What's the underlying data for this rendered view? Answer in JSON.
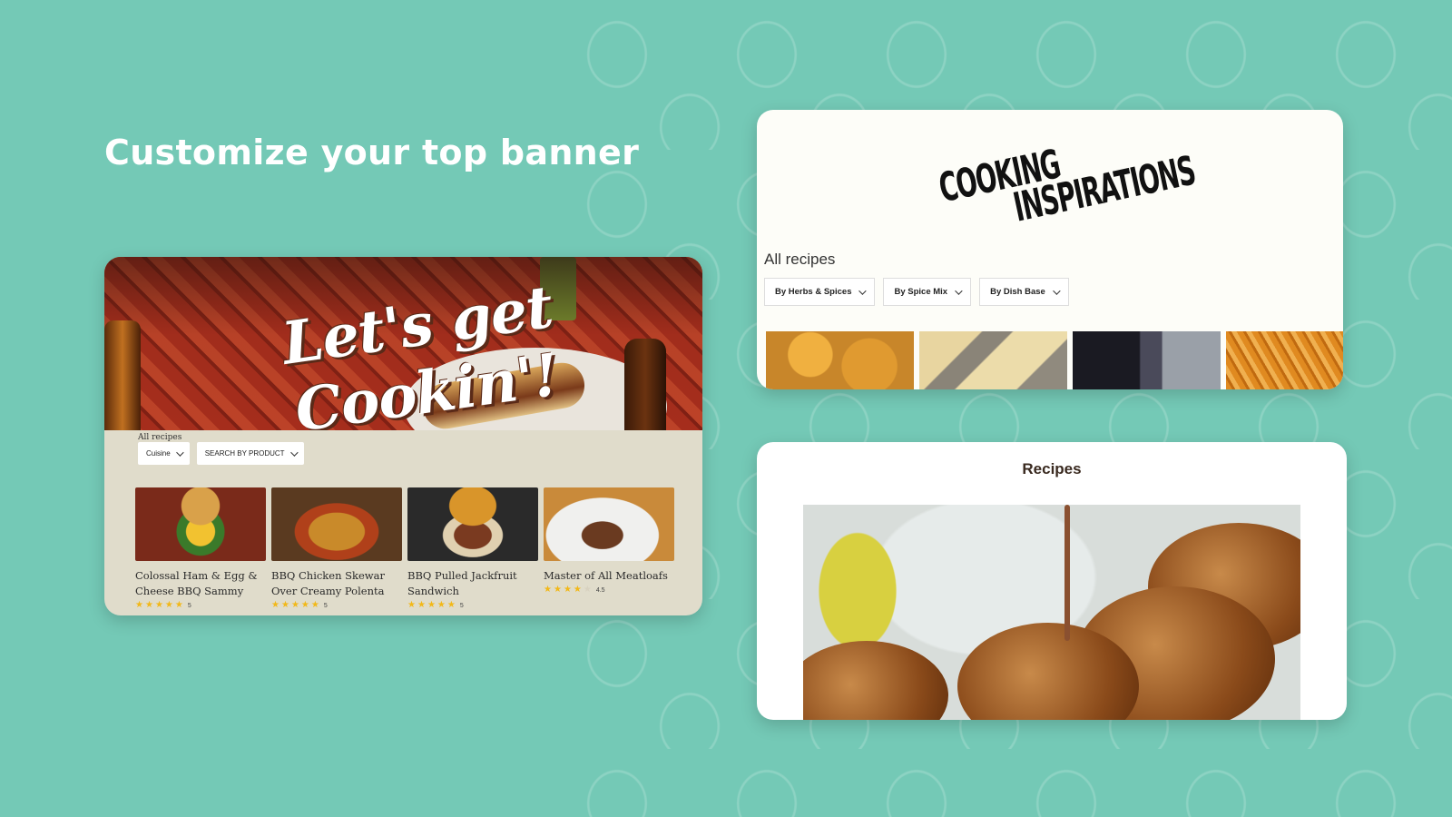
{
  "headline": "Customize your top banner",
  "card_banner": {
    "banner_title": "Let's get Cookin'!",
    "section_label": "All recipes",
    "filters": [
      {
        "label": "Cuisine",
        "icon": "chevron-down-icon"
      },
      {
        "label": "SEARCH BY PRODUCT",
        "icon": "chevron-down-icon"
      }
    ],
    "recipes": [
      {
        "name": "Colossal Ham & Egg & Cheese BBQ Sammy",
        "rating": 5,
        "rating_label": "5"
      },
      {
        "name": "BBQ Chicken Skewar Over Creamy Polenta",
        "rating": 5,
        "rating_label": "5"
      },
      {
        "name": "BBQ Pulled Jackfruit Sandwich",
        "rating": 5,
        "rating_label": "5"
      },
      {
        "name": "Master of All Meatloafs",
        "rating": 4.5,
        "rating_label": "4.5"
      }
    ]
  },
  "card_inspirations": {
    "logo_line1": "COOKING",
    "logo_line2": "INSPIRATIONS",
    "section_label": "All recipes",
    "filters": [
      {
        "label": "By Herbs & Spices",
        "icon": "chevron-down-icon"
      },
      {
        "label": "By Spice Mix",
        "icon": "chevron-down-icon"
      },
      {
        "label": "By Dish Base",
        "icon": "chevron-down-icon"
      }
    ]
  },
  "card_recipes": {
    "title": "Recipes"
  },
  "colors": {
    "background": "#74c9b6",
    "star": "#f2b818",
    "card_banner_bg": "#e0dccb"
  }
}
